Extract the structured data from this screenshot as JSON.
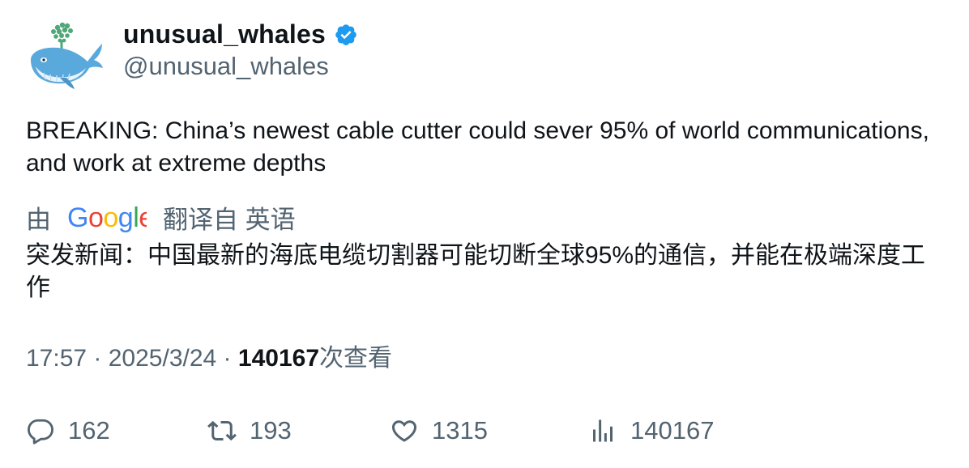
{
  "author": {
    "display_name": "unusual_whales",
    "handle": "@unusual_whales",
    "verified": true,
    "verified_color": "#1d9bf0",
    "avatar_icon": "whale-logo-icon"
  },
  "tweet": {
    "text": "BREAKING: China’s newest cable cutter could sever 95% of world communications, and work at extreme depths"
  },
  "translation": {
    "prefix": "由",
    "provider": "Google",
    "suffix": "翻译自 英语",
    "text": "突发新闻：中国最新的海底电缆切割器可能切断全球95%的通信，并能在极端深度工作"
  },
  "meta": {
    "time": "17:57",
    "separator": " · ",
    "date": "2025/3/24",
    "views_count": "140167",
    "views_label": "次查看"
  },
  "actions": {
    "replies": "162",
    "retweets": "193",
    "likes": "1315",
    "views": "140167"
  }
}
